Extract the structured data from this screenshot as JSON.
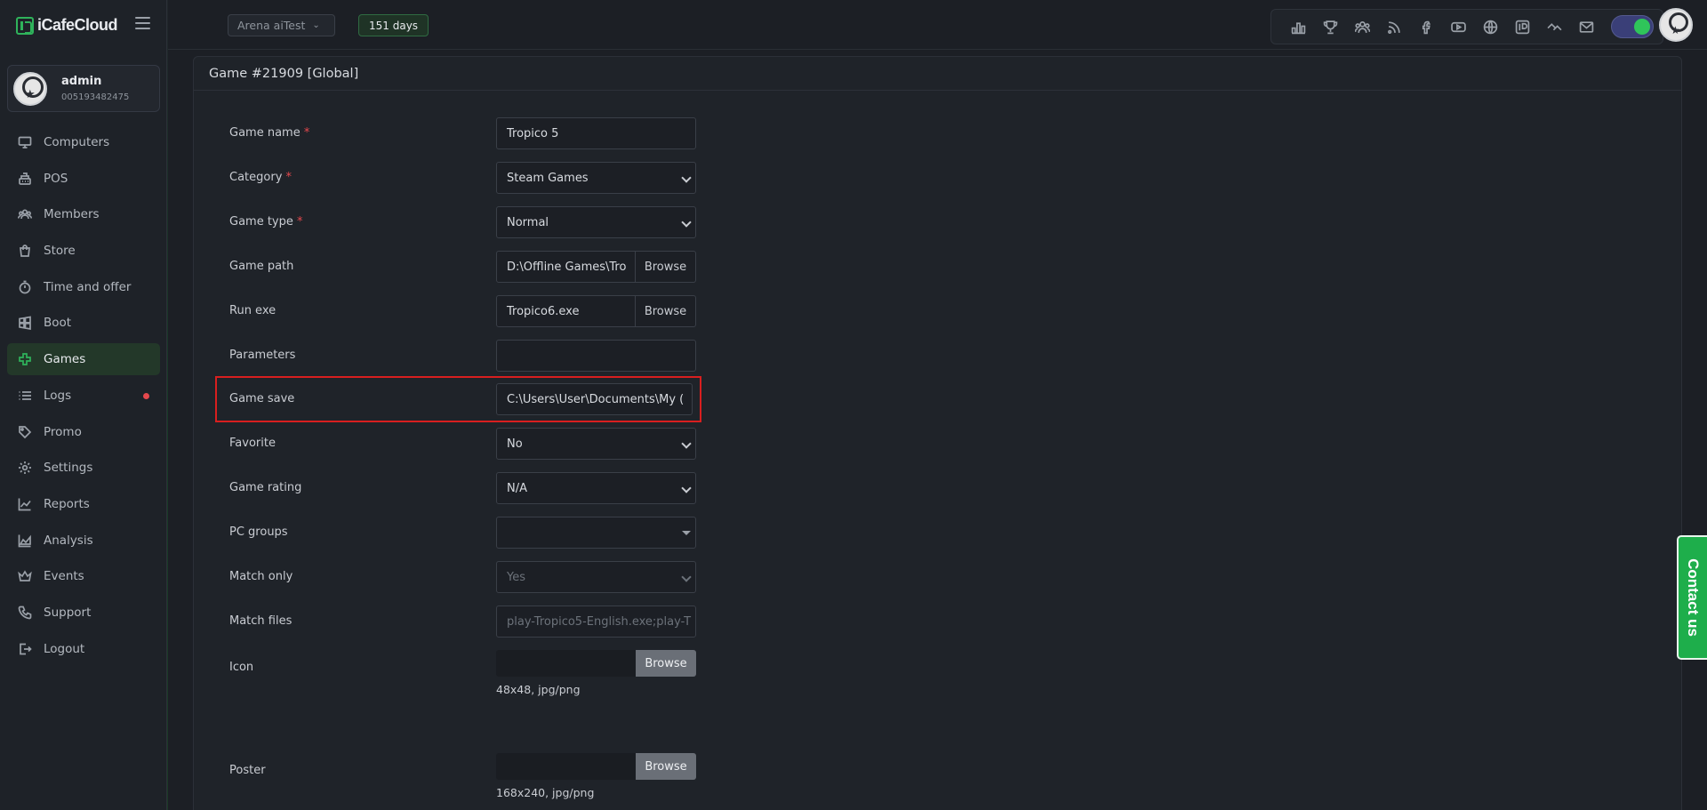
{
  "brand": {
    "name": "iCafeCloud"
  },
  "user": {
    "name": "admin",
    "id": "005193482475"
  },
  "sidebar": {
    "items": [
      {
        "label": "Computers",
        "icon": "monitor-icon"
      },
      {
        "label": "POS",
        "icon": "cash-register-icon"
      },
      {
        "label": "Members",
        "icon": "users-icon"
      },
      {
        "label": "Store",
        "icon": "shopping-bag-icon"
      },
      {
        "label": "Time and offer",
        "icon": "stopwatch-icon"
      },
      {
        "label": "Boot",
        "icon": "windows-icon"
      },
      {
        "label": "Games",
        "icon": "gamepad-icon",
        "active": true
      },
      {
        "label": "Logs",
        "icon": "list-icon",
        "badge_color": "#e5484d"
      },
      {
        "label": "Promo",
        "icon": "tag-icon"
      },
      {
        "label": "Settings",
        "icon": "gear-icon"
      },
      {
        "label": "Reports",
        "icon": "line-chart-icon"
      },
      {
        "label": "Analysis",
        "icon": "area-chart-icon"
      },
      {
        "label": "Events",
        "icon": "crown-icon"
      },
      {
        "label": "Support",
        "icon": "phone-icon"
      },
      {
        "label": "Logout",
        "icon": "logout-icon"
      }
    ]
  },
  "topbar": {
    "store": "Arena aiTest",
    "days": "151 days",
    "icons": [
      "ranking-icon",
      "trophy-icon",
      "group-icon",
      "rss-icon",
      "facebook-icon",
      "youtube-icon",
      "globe-icon",
      "icafecloud-icon",
      "remote-icon",
      "mail-icon"
    ],
    "toggle_on": true
  },
  "page": {
    "title": "Game #21909 [Global]"
  },
  "form": {
    "game_name": {
      "label": "Game name",
      "value": "Tropico 5"
    },
    "category": {
      "label": "Category",
      "value": "Steam Games"
    },
    "game_type": {
      "label": "Game type",
      "value": "Normal"
    },
    "game_path": {
      "label": "Game path",
      "value": "D:\\Offline Games\\Tro",
      "button": "Browse"
    },
    "run_exe": {
      "label": "Run exe",
      "value": "Tropico6.exe",
      "button": "Browse"
    },
    "parameters": {
      "label": "Parameters",
      "value": ""
    },
    "game_save": {
      "label": "Game save",
      "value": "C:\\Users\\User\\Documents\\My ("
    },
    "favorite": {
      "label": "Favorite",
      "value": "No"
    },
    "game_rating": {
      "label": "Game rating",
      "value": "N/A"
    },
    "pc_groups": {
      "label": "PC groups",
      "value": ""
    },
    "match_only": {
      "label": "Match only",
      "value": "Yes"
    },
    "match_files": {
      "label": "Match files",
      "value": "play-Tropico5-English.exe;play-T"
    },
    "icon": {
      "label": "Icon",
      "button": "Browse",
      "hint": "48x48, jpg/png"
    },
    "poster": {
      "label": "Poster",
      "button": "Browse",
      "hint": "168x240, jpg/png"
    },
    "required_mark": "*"
  },
  "contact": {
    "label": "Contact us"
  },
  "colors": {
    "accent": "#2fb35b",
    "highlight": "#d81f1f",
    "danger": "#e5484d",
    "contact": "#1eae4b"
  }
}
